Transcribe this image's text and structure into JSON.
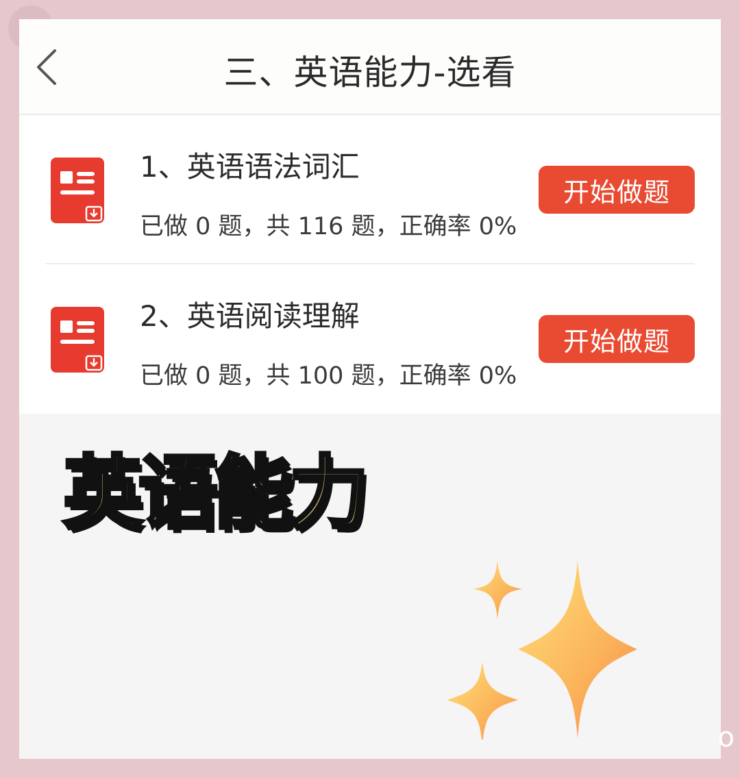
{
  "header": {
    "title": "三、英语能力-选看",
    "back_icon": "chevron-left-icon"
  },
  "items": [
    {
      "title": "1、英语语法词汇",
      "stats": "已做 0 题，共 116 题，正确率 0%",
      "button_label": "开始做题",
      "icon": "document-download-icon"
    },
    {
      "title": "2、英语阅读理解",
      "stats": "已做 0 题，共 100 题，正确率 0%",
      "button_label": "开始做题",
      "icon": "document-download-icon"
    }
  ],
  "banner": {
    "title": "英语能力"
  },
  "corner": {
    "glyph": "o"
  },
  "colors": {
    "accent": "#e84b32",
    "banner_text": "#fbe08a",
    "background": "#e6c8cc"
  }
}
